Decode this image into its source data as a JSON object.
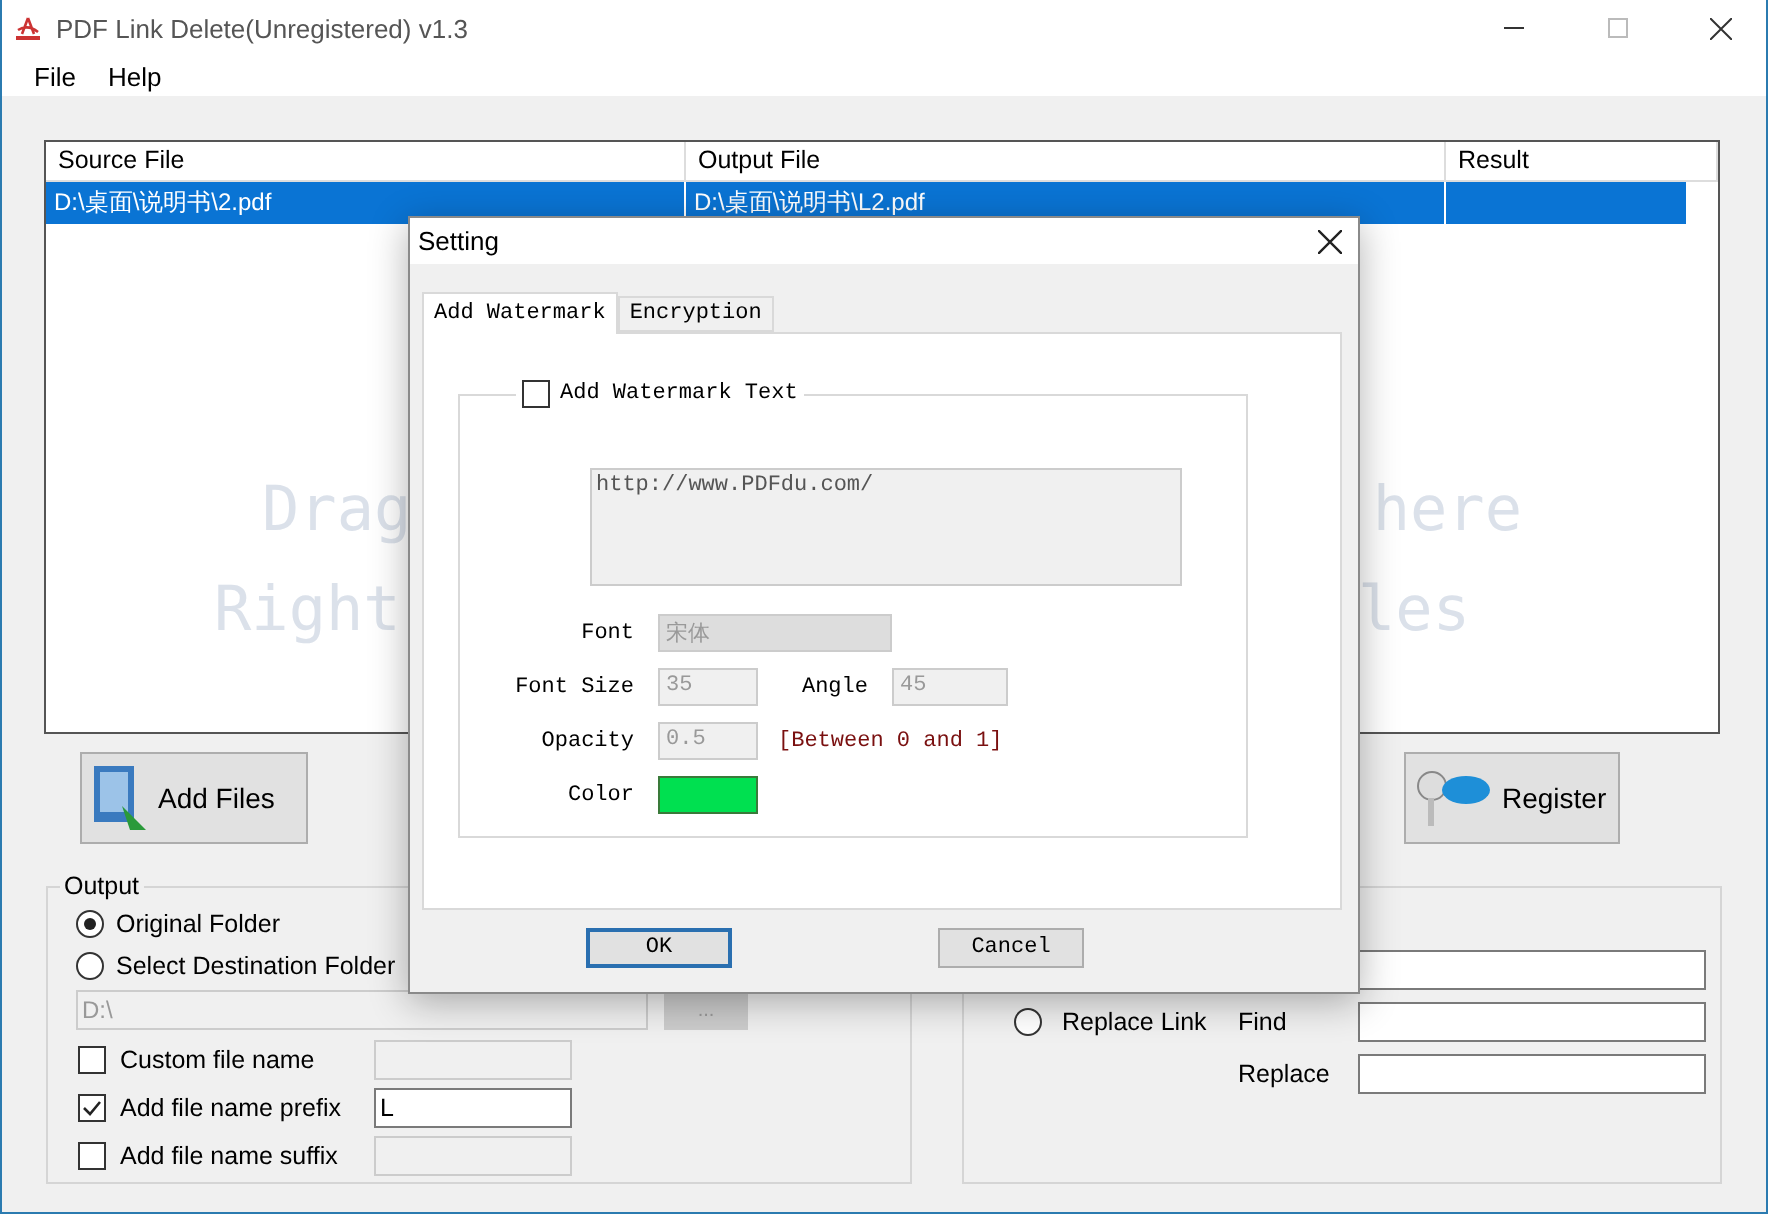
{
  "window": {
    "title": "PDF Link Delete(Unregistered) v1.3"
  },
  "menu": [
    "File",
    "Help"
  ],
  "table": {
    "columns": [
      "Source File",
      "Output File",
      "Result"
    ],
    "rows": [
      {
        "source": "D:\\桌面\\说明书\\2.pdf",
        "output": "D:\\桌面\\说明书\\L2.pdf",
        "selected": true
      }
    ],
    "hint_lines": [
      [
        "Drag",
        "here"
      ],
      [
        "Right",
        "les"
      ]
    ]
  },
  "add_files": "Add Files",
  "register": "Register",
  "output": {
    "title": "Output",
    "options": [
      {
        "label": "Original Folder",
        "selected": true
      },
      {
        "label": "Select Destination Folder",
        "selected": false
      }
    ],
    "folder": "D:\\",
    "browse": "...",
    "naming": [
      {
        "label": "Custom file name",
        "checked": false
      },
      {
        "label": "Add file name prefix",
        "checked": true,
        "value": "L"
      },
      {
        "label": "Add file name suffix",
        "checked": false
      }
    ]
  },
  "link_group": {
    "replace_option": {
      "label": "Replace Link",
      "selected": false
    },
    "find_label": "Find",
    "replace_label": "Replace"
  },
  "dialog": {
    "title": "Setting",
    "tabs": [
      {
        "label": "Add Watermark",
        "selected": true
      },
      {
        "label": "Encryption",
        "selected": false
      }
    ],
    "watermark_text": {
      "label": "Add Watermark Text",
      "checked": false
    },
    "text": "http://www.PDFdu.com/",
    "font": {
      "label": "Font",
      "value": "宋体"
    },
    "font_size": {
      "label": "Font Size",
      "value": "35"
    },
    "angle": {
      "label": "Angle",
      "value": "45"
    },
    "opacity": {
      "label": "Opacity",
      "value": "0.5",
      "hint": "[Between 0 and 1]"
    },
    "color": {
      "label": "Color",
      "color": "#00e050"
    },
    "ok": "OK",
    "cancel": "Cancel"
  }
}
